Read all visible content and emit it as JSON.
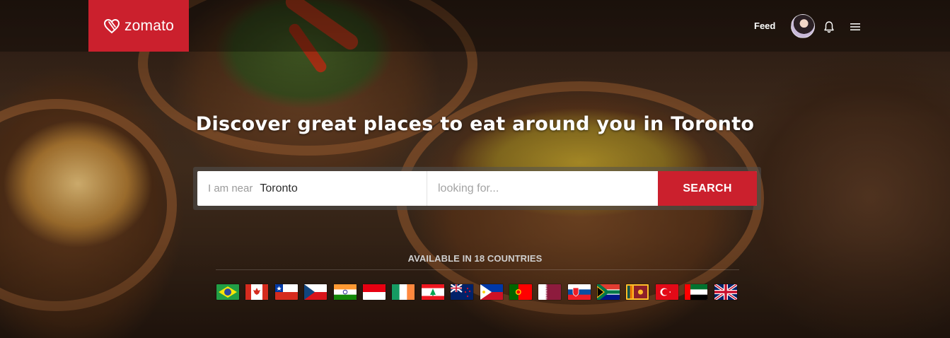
{
  "brand": {
    "name": "zomato",
    "color": "#cb202d"
  },
  "nav": {
    "feed_label": "Feed"
  },
  "hero": {
    "headline": "Discover great places to eat around you in Toronto"
  },
  "search": {
    "location_prefix": "I am near",
    "location_value": "Toronto",
    "query_placeholder": "looking for...",
    "button_label": "SEARCH"
  },
  "countries": {
    "label": "AVAILABLE IN 18 COUNTRIES",
    "flags": [
      "brazil",
      "canada",
      "chile",
      "czech-republic",
      "india",
      "indonesia",
      "ireland",
      "lebanon",
      "new-zealand",
      "philippines",
      "portugal",
      "qatar",
      "slovakia",
      "south-africa",
      "sri-lanka",
      "turkey",
      "uae",
      "united-kingdom"
    ]
  },
  "icons": {
    "logo": "heart-fork-icon",
    "notifications": "bell-icon",
    "menu": "hamburger-menu-icon"
  }
}
